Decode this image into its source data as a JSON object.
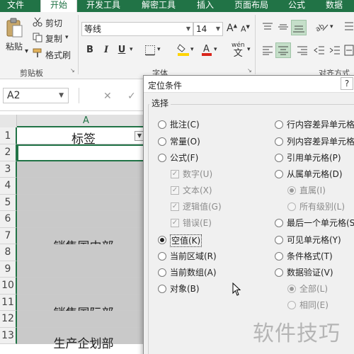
{
  "colors": {
    "brand": "#217346",
    "selection": "#c9c9c9",
    "font_color_accent": "#d9261c",
    "fill_accent": "#ffd400"
  },
  "tabs": [
    "文件",
    "开始",
    "开发工具",
    "解密工具",
    "插入",
    "页面布局",
    "公式",
    "数据"
  ],
  "active_tab": "开始",
  "ribbon": {
    "paste_label": "粘贴",
    "cut_label": "剪切",
    "copy_label": "复制",
    "format_painter_label": "格式刷",
    "clipboard_group": "剪贴板",
    "font_name": "等线",
    "font_size": "14",
    "grow_font": "A",
    "shrink_font": "A",
    "bold": "B",
    "italic": "I",
    "underline": "U",
    "phonetic_label": "wén",
    "phonetic_sub": "文",
    "font_group": "字体",
    "align_group": "对齐方式",
    "icons": [
      "paste-icon",
      "cut-icon",
      "copy-icon",
      "format-painter-icon",
      "borders-icon",
      "fill-color-icon",
      "font-color-icon",
      "align-icon",
      "orientation-icon",
      "wrap-text-icon",
      "merge-icon"
    ]
  },
  "formula_bar": {
    "name_box": "A2",
    "cancel": "✕",
    "enter": "✓"
  },
  "sheet": {
    "column_header": "A",
    "rows": [
      {
        "num": "1",
        "text": "标签"
      },
      {
        "num": "2",
        "text": ""
      },
      {
        "num": "3",
        "text": ""
      },
      {
        "num": "4",
        "text": ""
      },
      {
        "num": "5",
        "text": ""
      },
      {
        "num": "6",
        "text": ""
      },
      {
        "num": "7",
        "text": "销售国内部"
      },
      {
        "num": "8",
        "text": ""
      },
      {
        "num": "9",
        "text": ""
      },
      {
        "num": "10",
        "text": ""
      },
      {
        "num": "11",
        "text": "销售国际部"
      },
      {
        "num": "12",
        "text": ""
      },
      {
        "num": "13",
        "text": "生产企划部"
      }
    ]
  },
  "dialog": {
    "title": "定位条件",
    "help": "?",
    "group_title": "选择",
    "left_options": [
      {
        "label": "批注(C)",
        "type": "radio",
        "checked": false,
        "disabled": false
      },
      {
        "label": "常量(O)",
        "type": "radio",
        "checked": false,
        "disabled": false
      },
      {
        "label": "公式(F)",
        "type": "radio",
        "checked": false,
        "disabled": false
      },
      {
        "label": "数字(U)",
        "type": "check",
        "checked": true,
        "disabled": true
      },
      {
        "label": "文本(X)",
        "type": "check",
        "checked": true,
        "disabled": true
      },
      {
        "label": "逻辑值(G)",
        "type": "check",
        "checked": true,
        "disabled": true
      },
      {
        "label": "错误(E)",
        "type": "check",
        "checked": true,
        "disabled": true
      },
      {
        "label": "空值(K)",
        "type": "radio",
        "checked": true,
        "disabled": false
      },
      {
        "label": "当前区域(R)",
        "type": "radio",
        "checked": false,
        "disabled": false
      },
      {
        "label": "当前数组(A)",
        "type": "radio",
        "checked": false,
        "disabled": false
      },
      {
        "label": "对象(B)",
        "type": "radio",
        "checked": false,
        "disabled": false
      }
    ],
    "right_options": [
      {
        "label": "行内容差异单元格",
        "type": "radio",
        "checked": false,
        "disabled": false
      },
      {
        "label": "列内容差异单元格",
        "type": "radio",
        "checked": false,
        "disabled": false
      },
      {
        "label": "引用单元格(P)",
        "type": "radio",
        "checked": false,
        "disabled": false
      },
      {
        "label": "从属单元格(D)",
        "type": "radio",
        "checked": false,
        "disabled": false
      },
      {
        "label": "直属(I)",
        "type": "radio",
        "checked": true,
        "disabled": true
      },
      {
        "label": "所有级别(L)",
        "type": "radio",
        "checked": false,
        "disabled": true
      },
      {
        "label": "最后一个单元格(S)",
        "type": "radio",
        "checked": false,
        "disabled": false
      },
      {
        "label": "可见单元格(Y)",
        "type": "radio",
        "checked": false,
        "disabled": false
      },
      {
        "label": "条件格式(T)",
        "type": "radio",
        "checked": false,
        "disabled": false
      },
      {
        "label": "数据验证(V)",
        "type": "radio",
        "checked": false,
        "disabled": false
      },
      {
        "label": "全部(L)",
        "type": "radio",
        "checked": true,
        "disabled": true
      },
      {
        "label": "相同(E)",
        "type": "radio",
        "checked": false,
        "disabled": true
      }
    ]
  },
  "watermark": "软件技巧"
}
